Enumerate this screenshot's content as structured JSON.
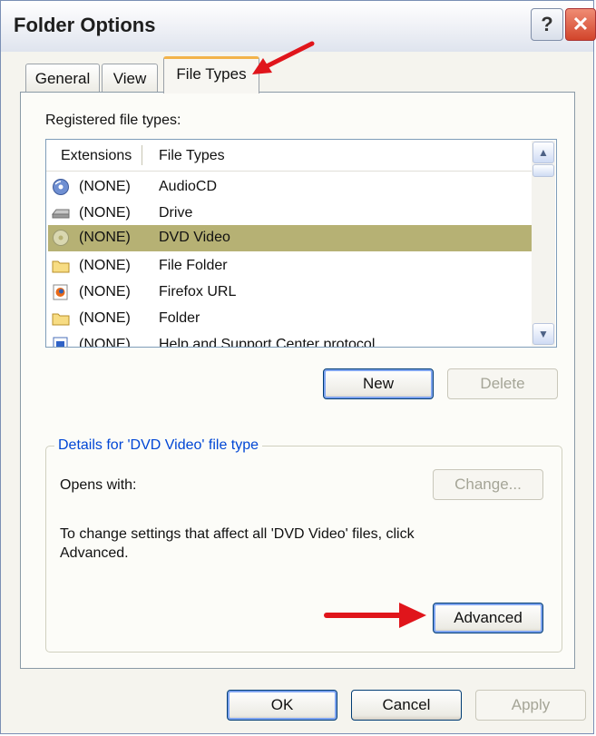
{
  "window": {
    "title": "Folder Options"
  },
  "tabs": [
    {
      "label": "General"
    },
    {
      "label": "View"
    },
    {
      "label": "File Types"
    }
  ],
  "registered_label": "Registered file types:",
  "list": {
    "columns": [
      "Extensions",
      "File Types"
    ],
    "rows": [
      {
        "ext": "(NONE)",
        "type": "AudioCD",
        "icon": "cd-icon"
      },
      {
        "ext": "(NONE)",
        "type": "Drive",
        "icon": "drive-icon"
      },
      {
        "ext": "(NONE)",
        "type": "DVD Video",
        "icon": "dvd-icon",
        "selected": true
      },
      {
        "ext": "(NONE)",
        "type": "File Folder",
        "icon": "folder-icon"
      },
      {
        "ext": "(NONE)",
        "type": "Firefox URL",
        "icon": "firefox-icon"
      },
      {
        "ext": "(NONE)",
        "type": "Folder",
        "icon": "folder-icon"
      },
      {
        "ext": "(NONE)",
        "type": "Help and Support Center protocol",
        "icon": "help-file-icon"
      }
    ]
  },
  "buttons": {
    "new": "New",
    "delete": "Delete",
    "change": "Change...",
    "advanced": "Advanced",
    "ok": "OK",
    "cancel": "Cancel",
    "apply": "Apply"
  },
  "details": {
    "legend": "Details for 'DVD Video' file type",
    "opens_with_label": "Opens with:",
    "info_line1": "To change settings that affect all 'DVD Video' files, click",
    "info_line2": "Advanced."
  },
  "colors": {
    "annotation_arrow": "#e0151b",
    "highlight": "#fbf794",
    "selection": "#b6b174",
    "legend_text": "#0046d5"
  }
}
